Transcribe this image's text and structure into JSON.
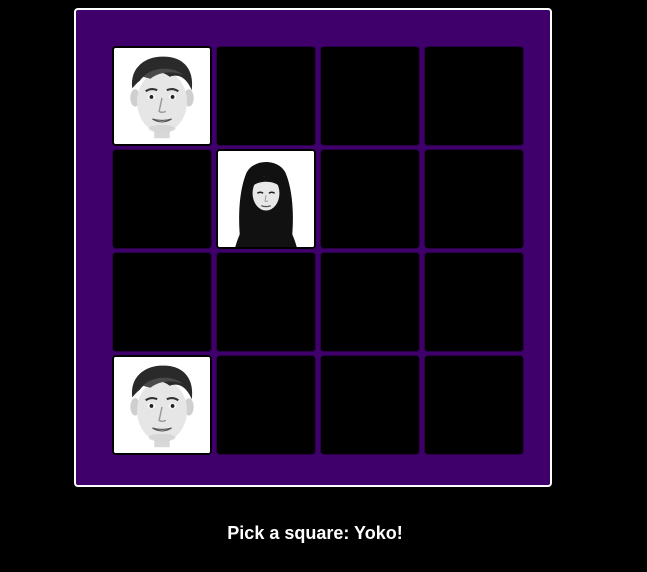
{
  "status_text": "Pick a square: Yoko!",
  "colors": {
    "page_background": "#000000",
    "board_background": "#3f006c",
    "board_border": "#ffffff",
    "hidden_tile": "#000000",
    "revealed_tile": "#ffffff"
  },
  "grid": {
    "rows": 4,
    "cols": 4,
    "cells": [
      {
        "row": 1,
        "col": 1,
        "state": "revealed",
        "face": "paul"
      },
      {
        "row": 1,
        "col": 2,
        "state": "hidden",
        "face": ""
      },
      {
        "row": 1,
        "col": 3,
        "state": "hidden",
        "face": ""
      },
      {
        "row": 1,
        "col": 4,
        "state": "hidden",
        "face": ""
      },
      {
        "row": 2,
        "col": 1,
        "state": "hidden",
        "face": ""
      },
      {
        "row": 2,
        "col": 2,
        "state": "revealed",
        "face": "yoko"
      },
      {
        "row": 2,
        "col": 3,
        "state": "hidden",
        "face": ""
      },
      {
        "row": 2,
        "col": 4,
        "state": "hidden",
        "face": ""
      },
      {
        "row": 3,
        "col": 1,
        "state": "hidden",
        "face": ""
      },
      {
        "row": 3,
        "col": 2,
        "state": "hidden",
        "face": ""
      },
      {
        "row": 3,
        "col": 3,
        "state": "hidden",
        "face": ""
      },
      {
        "row": 3,
        "col": 4,
        "state": "hidden",
        "face": ""
      },
      {
        "row": 4,
        "col": 1,
        "state": "revealed",
        "face": "paul"
      },
      {
        "row": 4,
        "col": 2,
        "state": "hidden",
        "face": ""
      },
      {
        "row": 4,
        "col": 3,
        "state": "hidden",
        "face": ""
      },
      {
        "row": 4,
        "col": 4,
        "state": "hidden",
        "face": ""
      }
    ]
  }
}
